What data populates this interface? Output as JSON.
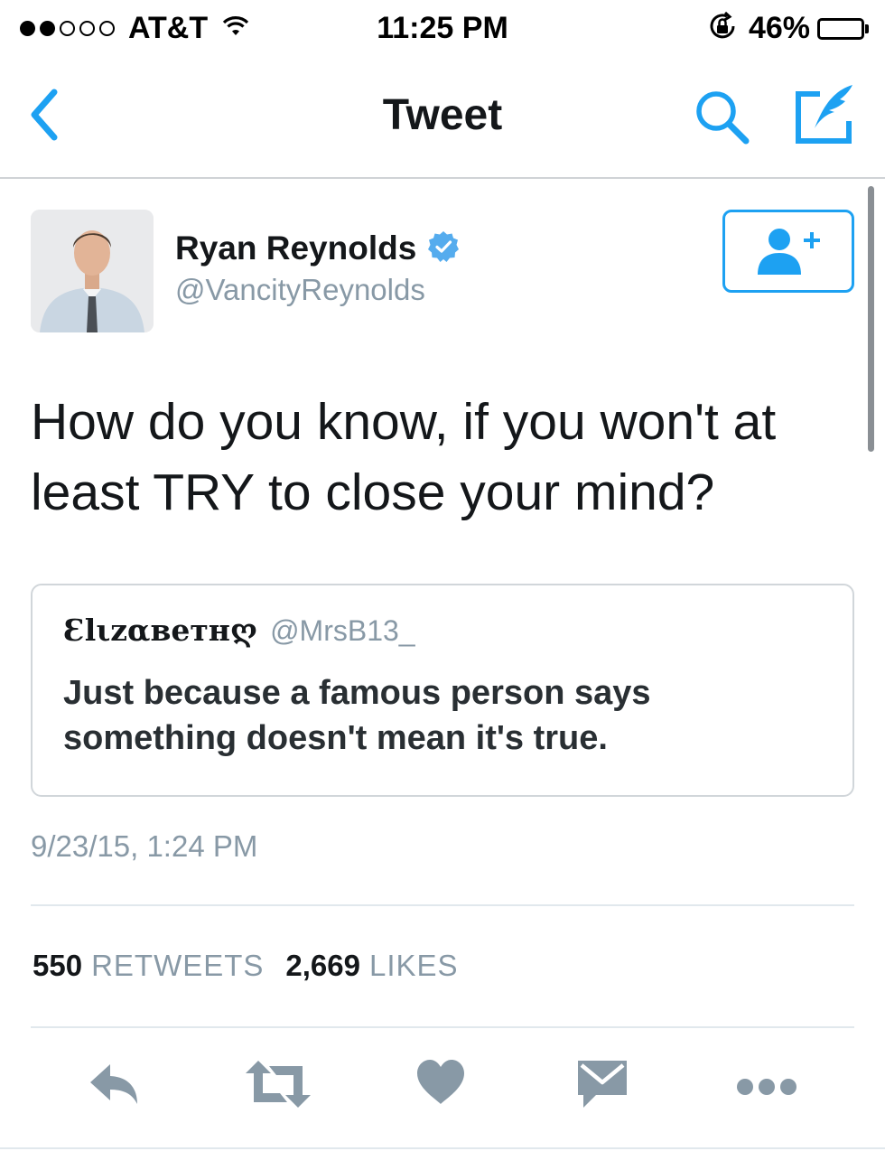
{
  "status_bar": {
    "carrier": "AT&T",
    "signal_icon": "signal-dots-icon",
    "wifi_icon": "wifi-icon",
    "time": "11:25 PM",
    "rotation_lock_icon": "rotation-lock-icon",
    "battery_percent": "46%",
    "battery_level": 0.46
  },
  "nav": {
    "title": "Tweet",
    "back_icon": "chevron-left-icon",
    "search_icon": "search-icon",
    "compose_icon": "compose-icon",
    "accent_color": "#1da1f2"
  },
  "tweet": {
    "author": {
      "name": "Ryan Reynolds",
      "handle": "@VancityReynolds",
      "verified": true
    },
    "text": "How do you know, if you won't at least TRY to close your mind?",
    "quote": {
      "name": "Ɛlιzαвeтнღ",
      "handle": "@MrsB13_",
      "text": "Just because a famous person says something doesn't mean it's true."
    },
    "timestamp": "9/23/15, 1:24 PM",
    "stats": {
      "retweets_count": "550",
      "retweets_label": "RETWEETS",
      "likes_count": "2,669",
      "likes_label": "LIKES"
    }
  },
  "actions": [
    "reply-icon",
    "retweet-icon",
    "like-icon",
    "direct-message-icon",
    "more-icon"
  ],
  "colors": {
    "accent": "#1da1f2",
    "secondary_text": "#8899a6",
    "icon_gray": "#8899a6"
  }
}
